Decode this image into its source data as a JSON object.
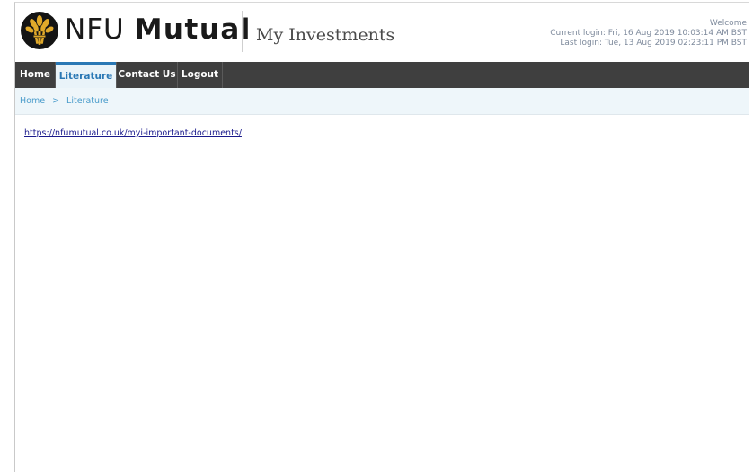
{
  "header": {
    "brand_part1": "NFU",
    "brand_part2": "Mutual",
    "logo_icon": "wheat-sheaf-logo-icon",
    "product": "My Investments",
    "welcome": "Welcome",
    "current_login": "Current login:  Fri, 16 Aug 2019 10:03:14 AM BST",
    "last_login": "Last login:  Tue, 13 Aug 2019 02:23:11 PM BST"
  },
  "nav": {
    "items": [
      {
        "label": "Home"
      },
      {
        "label": "Literature"
      },
      {
        "label": "Contact Us"
      },
      {
        "label": "Logout"
      }
    ],
    "active": "Literature"
  },
  "breadcrumb": {
    "items": [
      "Home",
      "Literature"
    ],
    "separator": ">"
  },
  "content": {
    "link_text": "https://nfumutual.co.uk/myi-important-documents/"
  },
  "colors": {
    "nav_background": "#3f3f3f",
    "accent": "#2a78b5",
    "breadcrumb_background": "#eef6fa"
  }
}
